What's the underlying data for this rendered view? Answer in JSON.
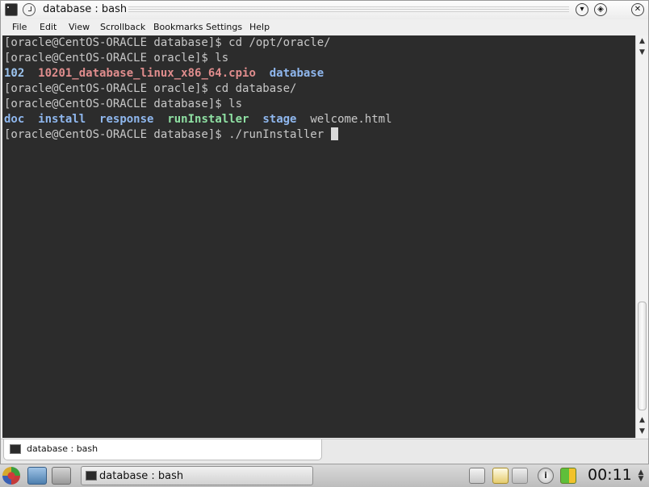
{
  "window": {
    "title": "database : bash"
  },
  "menu": {
    "file": "File",
    "edit": "Edit",
    "view": "View",
    "scrollback": "Scrollback",
    "bookmarks": "Bookmarks",
    "settings": "Settings",
    "help": "Help"
  },
  "terminal": {
    "lines": [
      {
        "prompt": "[oracle@CentOS-ORACLE database]$ ",
        "command": "cd /opt/oracle/"
      },
      {
        "prompt": "[oracle@CentOS-ORACLE oracle]$ ",
        "command": "ls"
      },
      {
        "listing": [
          {
            "text": "102",
            "kind": "dir"
          },
          {
            "text": "10201_database_linux_x86_64.cpio",
            "kind": "archive"
          },
          {
            "text": "database",
            "kind": "dir"
          }
        ]
      },
      {
        "prompt": "[oracle@CentOS-ORACLE oracle]$ ",
        "command": "cd database/"
      },
      {
        "prompt": "[oracle@CentOS-ORACLE database]$ ",
        "command": "ls"
      },
      {
        "listing": [
          {
            "text": "doc",
            "kind": "dir"
          },
          {
            "text": "install",
            "kind": "dir"
          },
          {
            "text": "response",
            "kind": "dir"
          },
          {
            "text": "runInstaller",
            "kind": "executable"
          },
          {
            "text": "stage",
            "kind": "dir"
          },
          {
            "text": "welcome.html",
            "kind": "file"
          }
        ]
      },
      {
        "prompt": "[oracle@CentOS-ORACLE database]$ ",
        "command": "./runInstaller "
      }
    ]
  },
  "session_tab": {
    "label": "database : bash"
  },
  "taskbar": {
    "task_label": "database : bash",
    "clock": "00:11",
    "icons": [
      "kde-menu-icon",
      "computer-icon",
      "drawer-icon",
      "desktops-icon",
      "clipboard-icon",
      "volume-icon",
      "info-icon",
      "power-icon"
    ]
  },
  "colors": {
    "terminal_bg": "#2c2c2c",
    "terminal_fg": "#c8c8c8",
    "directory": "#8fb7ee",
    "archive": "#e08d8d",
    "executable": "#8fe0a3"
  }
}
